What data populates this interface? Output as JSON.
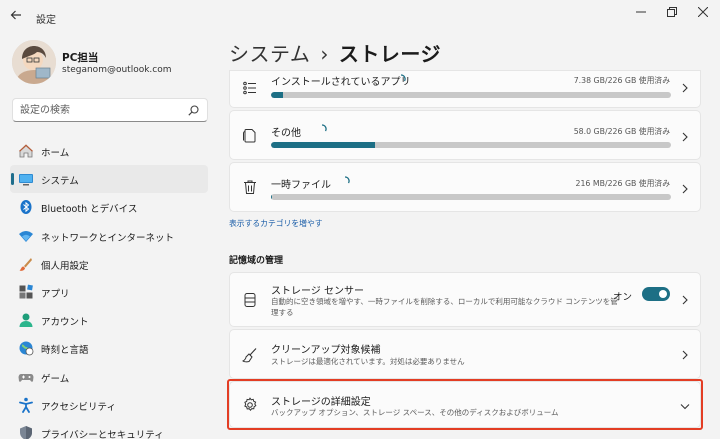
{
  "titlebar": {
    "back_icon": "back-arrow-icon",
    "title": "設定"
  },
  "profile": {
    "name": "PC担当",
    "email": "steganom@outlook.com"
  },
  "search": {
    "placeholder": "設定の検索",
    "icon": "search-icon"
  },
  "sidebar": {
    "items": [
      {
        "label": "ホーム",
        "icon": "home-icon",
        "active": false
      },
      {
        "label": "システム",
        "icon": "system-icon",
        "active": true
      },
      {
        "label": "Bluetooth とデバイス",
        "icon": "bluetooth-icon",
        "active": false
      },
      {
        "label": "ネットワークとインターネット",
        "icon": "network-icon",
        "active": false
      },
      {
        "label": "個人用設定",
        "icon": "brush-icon",
        "active": false
      },
      {
        "label": "アプリ",
        "icon": "apps-icon",
        "active": false
      },
      {
        "label": "アカウント",
        "icon": "account-icon",
        "active": false
      },
      {
        "label": "時刻と言語",
        "icon": "globe-icon",
        "active": false
      },
      {
        "label": "ゲーム",
        "icon": "gamepad-icon",
        "active": false
      },
      {
        "label": "アクセシビリティ",
        "icon": "accessibility-icon",
        "active": false
      },
      {
        "label": "プライバシーとセキュリティ",
        "icon": "shield-icon",
        "active": false
      }
    ]
  },
  "header": {
    "breadcrumb_parent": "システム",
    "separator": "›",
    "current": "ストレージ"
  },
  "storage_categories": [
    {
      "label": "インストールされているアプリ",
      "size": "7.38 GB/226 GB 使用済み",
      "usage_percent": 3,
      "icon": "list-icon"
    },
    {
      "label": "その他",
      "size": "58.0 GB/226 GB 使用済み",
      "usage_percent": 26,
      "icon": "document-icon"
    },
    {
      "label": "一時ファイル",
      "size": "216 MB/226 GB 使用済み",
      "usage_percent": 0.1,
      "icon": "trash-icon"
    }
  ],
  "show_more_link": "表示するカテゴリを増やす",
  "management": {
    "heading": "記憶域の管理",
    "storage_sense": {
      "title": "ストレージ センサー",
      "description": "自動的に空き領域を増やす、一時ファイルを削除する、ローカルで利用可能なクラウド コンテンツを管理する",
      "toggle_label": "オン",
      "toggle_on": true,
      "icon": "drive-icon"
    },
    "cleanup": {
      "title": "クリーンアップ対象候補",
      "description": "ストレージは最適化されています。対処は必要ありません",
      "icon": "broom-icon"
    },
    "advanced": {
      "title": "ストレージの詳細設定",
      "description": "バックアップ オプション、ストレージ スペース、その他のディスクおよびボリューム",
      "icon": "gear-icon"
    }
  },
  "colors": {
    "accent": "#1d6f85",
    "highlight": "#e33d24",
    "link": "#1b5ea8"
  }
}
